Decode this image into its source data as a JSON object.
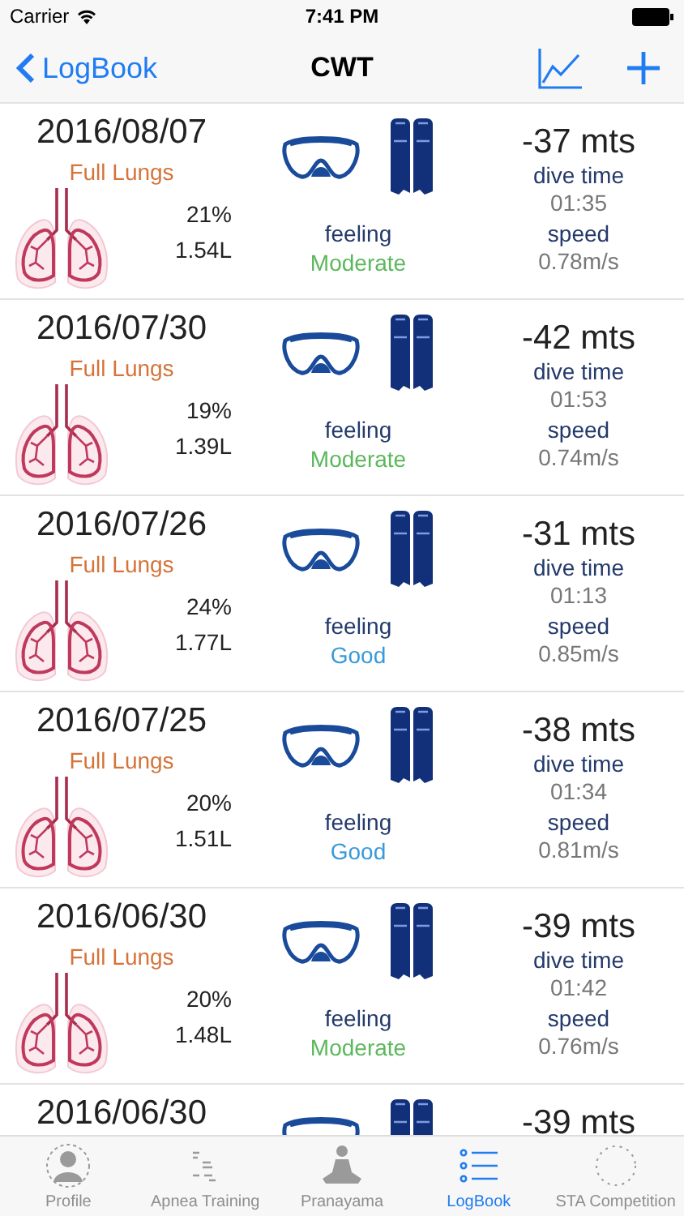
{
  "status_bar": {
    "carrier": "Carrier",
    "time": "7:41 PM"
  },
  "nav": {
    "back": "LogBook",
    "title": "CWT"
  },
  "dives": [
    {
      "date": "2016/08/07",
      "lungs": "Full Lungs",
      "percent": "21%",
      "volume": "1.54L",
      "feeling_label": "feeling",
      "feeling": {
        "text": "Moderate",
        "color": "#5cb85c"
      },
      "depth": "-37 mts",
      "time_label": "dive time",
      "time": "01:35",
      "speed_label": "speed",
      "speed": "0.78m/s"
    },
    {
      "date": "2016/07/30",
      "lungs": "Full Lungs",
      "percent": "19%",
      "volume": "1.39L",
      "feeling_label": "feeling",
      "feeling": {
        "text": "Moderate",
        "color": "#5cb85c"
      },
      "depth": "-42 mts",
      "time_label": "dive time",
      "time": "01:53",
      "speed_label": "speed",
      "speed": "0.74m/s"
    },
    {
      "date": "2016/07/26",
      "lungs": "Full Lungs",
      "percent": "24%",
      "volume": "1.77L",
      "feeling_label": "feeling",
      "feeling": {
        "text": "Good",
        "color": "#3a9ad9"
      },
      "depth": "-31 mts",
      "time_label": "dive time",
      "time": "01:13",
      "speed_label": "speed",
      "speed": "0.85m/s"
    },
    {
      "date": "2016/07/25",
      "lungs": "Full Lungs",
      "percent": "20%",
      "volume": "1.51L",
      "feeling_label": "feeling",
      "feeling": {
        "text": "Good",
        "color": "#3a9ad9"
      },
      "depth": "-38 mts",
      "time_label": "dive time",
      "time": "01:34",
      "speed_label": "speed",
      "speed": "0.81m/s"
    },
    {
      "date": "2016/06/30",
      "lungs": "Full Lungs",
      "percent": "20%",
      "volume": "1.48L",
      "feeling_label": "feeling",
      "feeling": {
        "text": "Moderate",
        "color": "#5cb85c"
      },
      "depth": "-39 mts",
      "time_label": "dive time",
      "time": "01:42",
      "speed_label": "speed",
      "speed": "0.76m/s"
    },
    {
      "date": "2016/06/30",
      "depth": "-39 mts"
    }
  ],
  "tabs": [
    {
      "label": "Profile",
      "selected": false,
      "kind": "profile"
    },
    {
      "label": "Apnea Training",
      "selected": false,
      "kind": "apnea"
    },
    {
      "label": "Pranayama",
      "selected": false,
      "kind": "pranayama"
    },
    {
      "label": "LogBook",
      "selected": true,
      "kind": "logbook"
    },
    {
      "label": "STA Competition",
      "selected": false,
      "kind": "sta"
    }
  ]
}
